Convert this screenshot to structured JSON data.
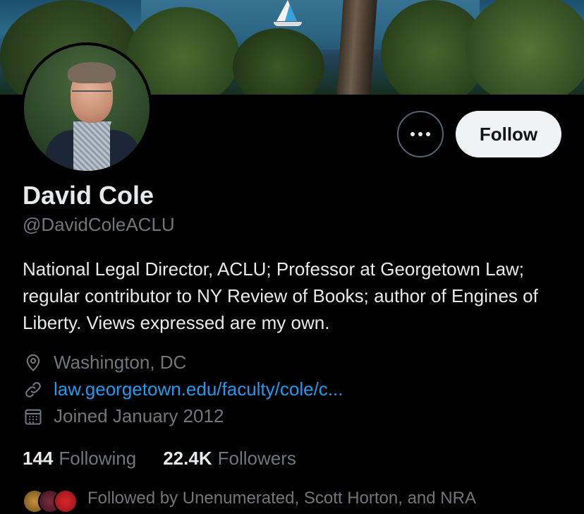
{
  "profile": {
    "name": "David Cole",
    "handle": "@DavidColeACLU",
    "bio": "National Legal Director, ACLU; Professor at Georgetown Law; regular contributor to NY Review of Books; author of Engines of Liberty. Views expressed are my own.",
    "location": "Washington, DC",
    "website": "law.georgetown.edu/faculty/cole/c...",
    "joined": "Joined January 2012"
  },
  "actions": {
    "follow_label": "Follow",
    "more_icon": "more-dots-icon"
  },
  "stats": {
    "following_count": "144",
    "following_label": "Following",
    "followers_count": "22.4K",
    "followers_label": "Followers"
  },
  "followed_by": {
    "text": "Followed by Unenumerated, Scott Horton, and NRA"
  },
  "colors": {
    "background": "#000000",
    "text_primary": "#e7e9ea",
    "text_secondary": "#71767b",
    "link": "#1d9bf0",
    "follow_button_bg": "#eff3f4"
  },
  "icons": {
    "location": "location-pin-icon",
    "link": "link-icon",
    "joined": "calendar-icon"
  }
}
